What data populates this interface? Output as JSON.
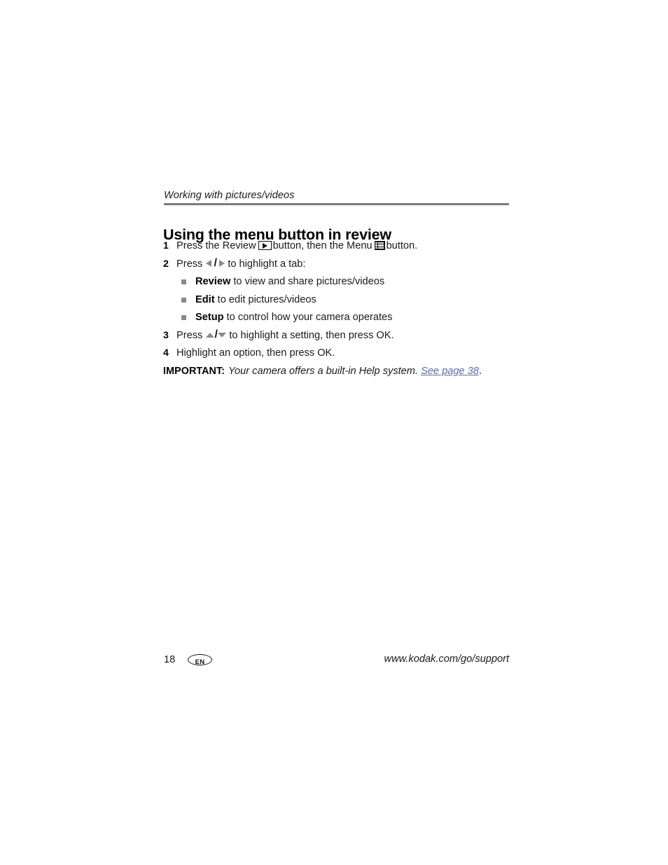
{
  "document": {
    "running_header": "Working with pictures/videos",
    "section_heading": "Using the menu button in review"
  },
  "steps": [
    {
      "number": "1",
      "text_before": "Press the Review",
      "icon_1": "review-play-icon",
      "text_middle": "button, then the Menu",
      "icon_2": "menu-list-icon",
      "text_after": "button."
    },
    {
      "number": "2",
      "text_before": "Press",
      "icon_1": "left-right-arrows-icon",
      "text_after": "to highlight a tab:"
    },
    {
      "number": "3",
      "text_before": "Press",
      "icon_1": "up-down-arrows-icon",
      "text_after": "to highlight a setting, then press OK."
    },
    {
      "number": "4",
      "text_before": "Highlight an option, then press OK."
    }
  ],
  "tabs": [
    {
      "term": "Review",
      "description": "to view and share pictures/videos"
    },
    {
      "term": "Edit",
      "description": "to edit pictures/videos"
    },
    {
      "term": "Setup",
      "description": "to control how your camera operates"
    }
  ],
  "important": {
    "label": "IMPORTANT:",
    "text": "Your camera offers a built-in Help system.",
    "link": "See page 38",
    "trailing": "."
  },
  "footer": {
    "page_number": "18",
    "language_badge": "EN",
    "url": "www.kodak.com/go/support"
  },
  "colors": {
    "rule": "#7b7b7b",
    "bullet": "#8a8a8a",
    "arrow": "#8a8a8a",
    "link": "#5b6ba4",
    "text": "#1a1a1a"
  }
}
